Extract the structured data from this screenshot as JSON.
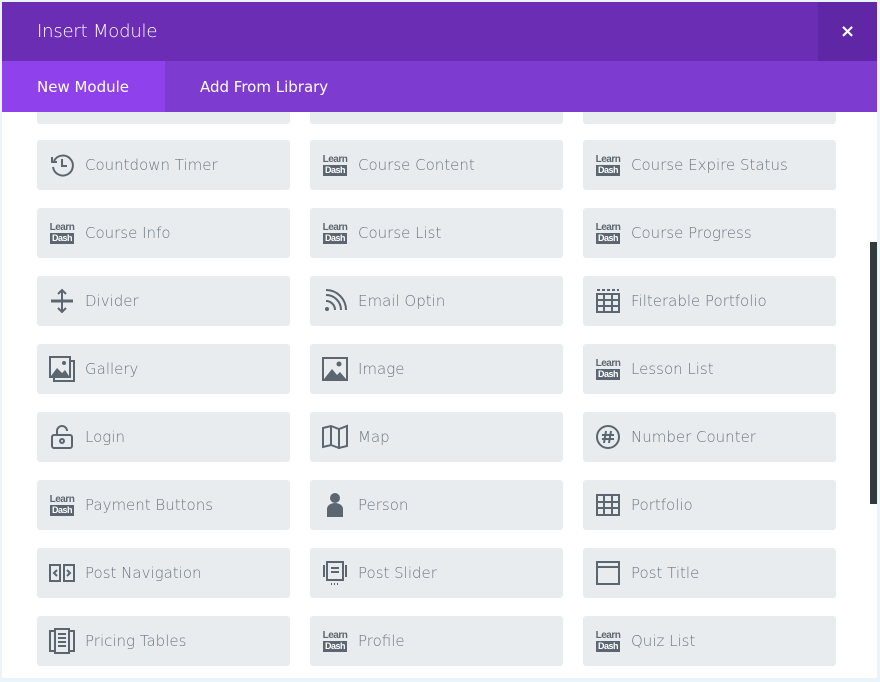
{
  "header": {
    "title": "Insert Module",
    "close_label": "×"
  },
  "tabs": [
    {
      "label": "New Module"
    },
    {
      "label": "Add From Library"
    }
  ],
  "modules": [
    {
      "label": "Countdown Timer",
      "icon": "clock-icon"
    },
    {
      "label": "Course Content",
      "icon": "learndash-icon"
    },
    {
      "label": "Course Expire Status",
      "icon": "learndash-icon"
    },
    {
      "label": "Course Info",
      "icon": "learndash-icon"
    },
    {
      "label": "Course List",
      "icon": "learndash-icon"
    },
    {
      "label": "Course Progress",
      "icon": "learndash-icon"
    },
    {
      "label": "Divider",
      "icon": "divider-icon"
    },
    {
      "label": "Email Optin",
      "icon": "rss-icon"
    },
    {
      "label": "Filterable Portfolio",
      "icon": "filter-grid-icon"
    },
    {
      "label": "Gallery",
      "icon": "gallery-icon"
    },
    {
      "label": "Image",
      "icon": "image-icon"
    },
    {
      "label": "Lesson List",
      "icon": "learndash-icon"
    },
    {
      "label": "Login",
      "icon": "lock-icon"
    },
    {
      "label": "Map",
      "icon": "map-icon"
    },
    {
      "label": "Number Counter",
      "icon": "hash-icon"
    },
    {
      "label": "Payment Buttons",
      "icon": "learndash-icon"
    },
    {
      "label": "Person",
      "icon": "person-icon"
    },
    {
      "label": "Portfolio",
      "icon": "grid-icon"
    },
    {
      "label": "Post Navigation",
      "icon": "post-navigation-icon"
    },
    {
      "label": "Post Slider",
      "icon": "slider-icon"
    },
    {
      "label": "Post Title",
      "icon": "window-icon"
    },
    {
      "label": "Pricing Tables",
      "icon": "pricing-icon"
    },
    {
      "label": "Profile",
      "icon": "learndash-icon"
    },
    {
      "label": "Quiz List",
      "icon": "learndash-icon"
    }
  ],
  "learndash": {
    "top": "Learn",
    "bottom": "Dash"
  },
  "colors": {
    "header": "#6a2db4",
    "tabs": "#7e3bd0",
    "active_tab": "#8f42ec",
    "card": "#e9ecef"
  }
}
